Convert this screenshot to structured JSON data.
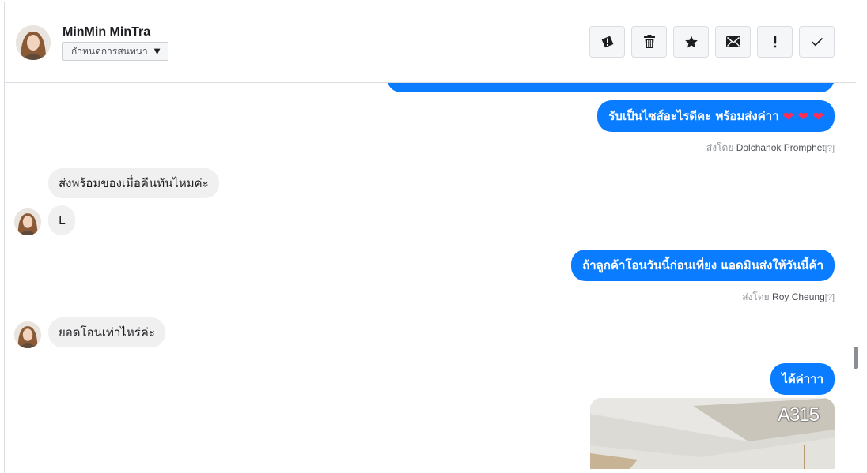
{
  "header": {
    "contact_name": "MinMin MinTra",
    "tag_label": "กำหนดการสนทนา",
    "actions": [
      {
        "name": "spam-alert",
        "icon": "exclamation-circle-icon"
      },
      {
        "name": "delete",
        "icon": "trash-icon"
      },
      {
        "name": "star",
        "icon": "star-icon"
      },
      {
        "name": "mark-unread",
        "icon": "envelope-icon"
      },
      {
        "name": "follow-up",
        "icon": "exclamation-icon"
      },
      {
        "name": "mark-done",
        "icon": "check-icon"
      }
    ]
  },
  "messages": {
    "m1": {
      "text": "รับเป็นไซส์อะไรดีคะ พร้อมส่งค่าา",
      "sent_by_prefix": "ส่งโดย",
      "sent_by": "Dolchanok Promphet",
      "help": "[?]",
      "hearts": "❤ ❤ ❤"
    },
    "m2": {
      "text": "ส่งพร้อมของเมื่อคืนทันไหมค่ะ"
    },
    "m3": {
      "text": "L"
    },
    "m4": {
      "text": "ถ้าลูกค้าโอนวันนี้ก่อนเที่ยง แอดมินส่งให้วันนี้ค้า",
      "sent_by_prefix": "ส่งโดย",
      "sent_by": "Roy Cheung",
      "help": "[?]"
    },
    "m5": {
      "text": "ยอดโอนเท่าไหร่ค่ะ"
    },
    "m6": {
      "text": "ได้ค่าาา"
    },
    "photo": {
      "label": "A315"
    }
  },
  "colors": {
    "outgoing": "#0a7cff",
    "incoming": "#f1f0f0",
    "heart": "#ff2d55"
  }
}
